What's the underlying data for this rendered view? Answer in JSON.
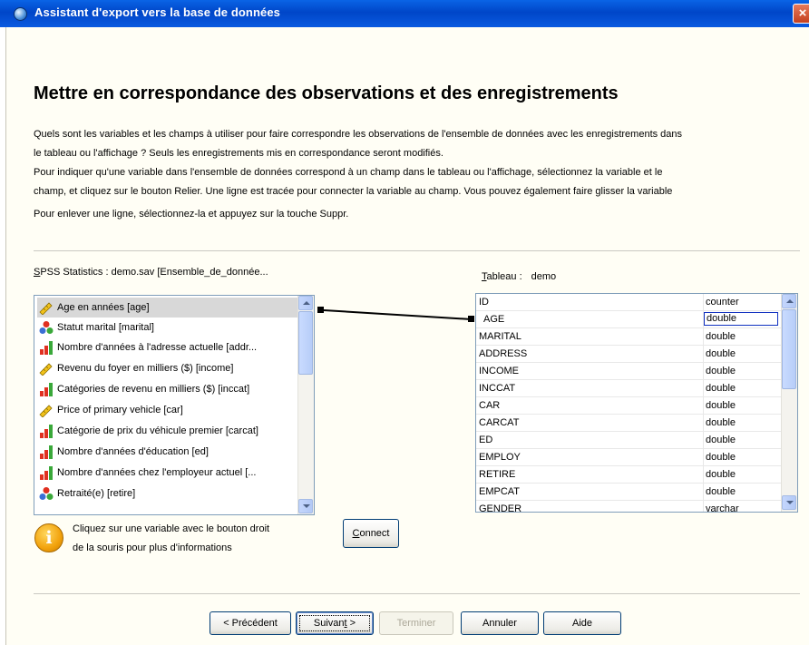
{
  "window": {
    "title": "Assistant d'export vers la base de données"
  },
  "header": {
    "heading": "Mettre en correspondance des observations et des enregistrements"
  },
  "instructions": [
    "Quels sont les variables et les champs à utiliser pour faire correspondre les observations de l'ensemble de données avec les enregistrements dans",
    "le tableau ou l'affichage ? Seuls les enregistrements mis en correspondance seront modifiés.",
    "Pour indiquer qu'une variable dans l'ensemble de données correspond à un champ dans le tableau ou l'affichage, sélectionnez la variable et le",
    "champ, et cliquez sur le bouton Relier. Une ligne est tracée pour connecter la variable au champ. Vous pouvez également faire glisser la variable",
    "Pour enlever une ligne, sélectionnez-la et appuyez sur la touche Suppr."
  ],
  "source": {
    "label_prefix": "S",
    "label_rest": "PSS Statistics :  demo.sav [Ensemble_de_donnée...",
    "variables": [
      {
        "label": "Age en années [age]",
        "icon": "scale-ruler-icon",
        "selected": true
      },
      {
        "label": "Statut marital [marital]",
        "icon": "nominal-icon"
      },
      {
        "label": "Nombre d'années à l'adresse actuelle [addr...",
        "icon": "ordinal-icon"
      },
      {
        "label": "Revenu du foyer en milliers ($) [income]",
        "icon": "scale-ruler-icon"
      },
      {
        "label": "Catégories de revenu en milliers ($) [inccat]",
        "icon": "ordinal-icon"
      },
      {
        "label": "Price of primary vehicle [car]",
        "icon": "scale-ruler-icon"
      },
      {
        "label": "Catégorie de prix du véhicule premier [carcat]",
        "icon": "ordinal-icon"
      },
      {
        "label": "Nombre d'années d'éducation [ed]",
        "icon": "ordinal-icon"
      },
      {
        "label": "Nombre d'années chez l'employeur actuel [...",
        "icon": "ordinal-icon"
      },
      {
        "label": "Retraité(e) [retire]",
        "icon": "nominal-icon"
      }
    ]
  },
  "target": {
    "label_prefix": "T",
    "label_rest": "ableau :",
    "table_name": "demo",
    "fields": [
      {
        "name": "ID",
        "type": "counter"
      },
      {
        "name": "AGE",
        "type": "double",
        "linked": true
      },
      {
        "name": "MARITAL",
        "type": "double"
      },
      {
        "name": "ADDRESS",
        "type": "double"
      },
      {
        "name": "INCOME",
        "type": "double"
      },
      {
        "name": "INCCAT",
        "type": "double"
      },
      {
        "name": "CAR",
        "type": "double"
      },
      {
        "name": "CARCAT",
        "type": "double"
      },
      {
        "name": "ED",
        "type": "double"
      },
      {
        "name": "EMPLOY",
        "type": "double"
      },
      {
        "name": "RETIRE",
        "type": "double"
      },
      {
        "name": "EMPCAT",
        "type": "double"
      },
      {
        "name": "GENDER",
        "type": "varchar"
      }
    ]
  },
  "hint": {
    "line1": "Cliquez sur une variable avec le bouton droit",
    "line2": "de la souris pour plus d'informations"
  },
  "connect_button": {
    "prefix": "C",
    "rest": "onnect"
  },
  "footer": {
    "back": "< Précédent",
    "next_prefix": "Suivan",
    "next_underlined": "t",
    "next_suffix": " >",
    "finish": "Terminer",
    "cancel": "Annuler",
    "help": "Aide"
  },
  "colors": {
    "title_bar": "#0050d8",
    "ordinal_red": "#e03020",
    "ordinal_green": "#3aa83a",
    "nominal_blue": "#3b6fd4",
    "scale_yellow": "#f2c21a"
  }
}
